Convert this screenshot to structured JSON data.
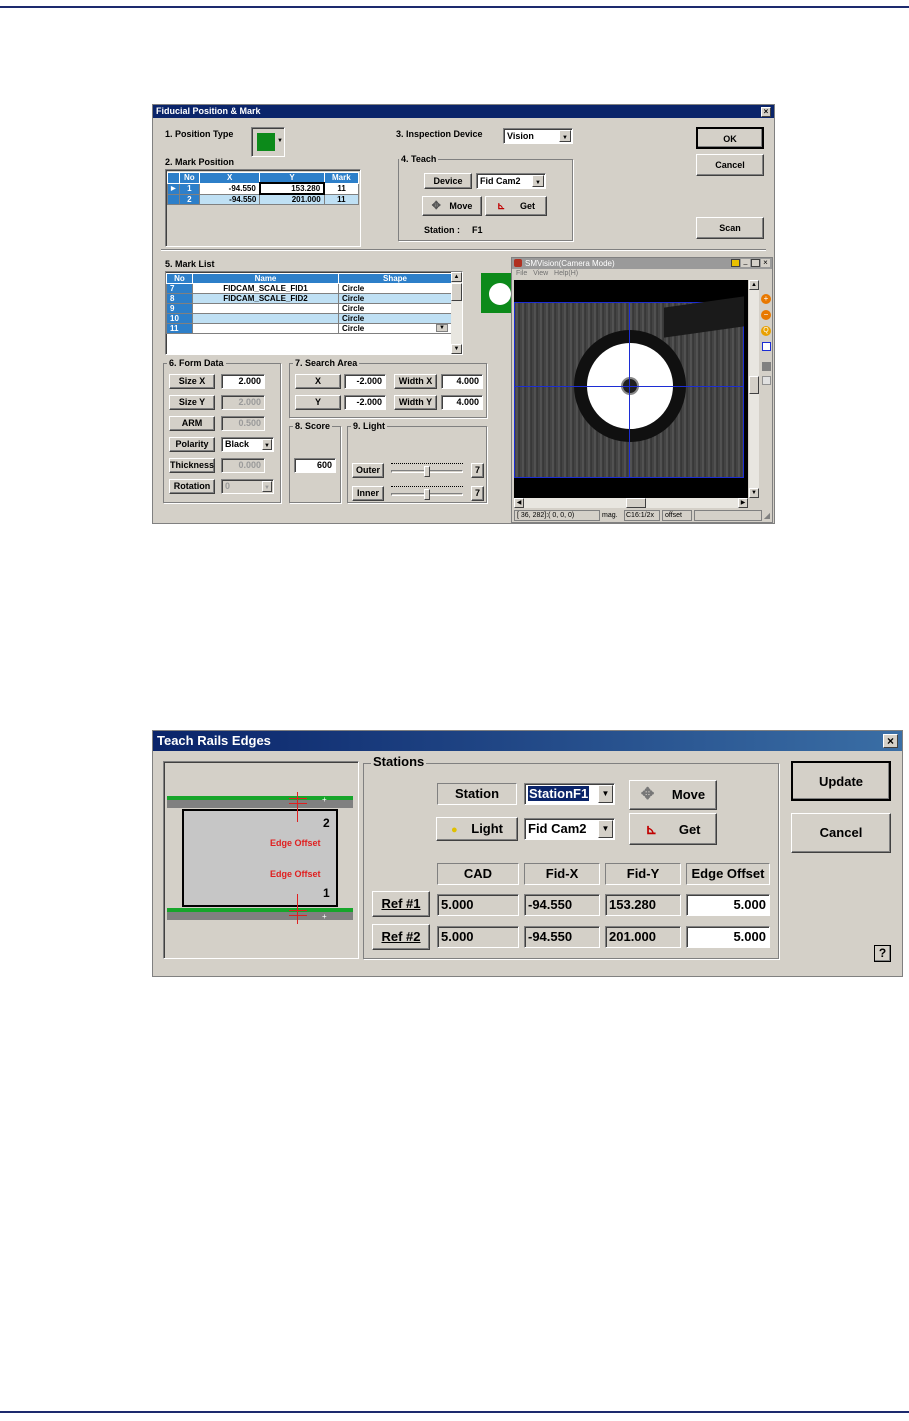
{
  "dialog1": {
    "title": "Fiducial Position & Mark",
    "position_type": {
      "label": "1. Position Type"
    },
    "mark_position": {
      "label": "2. Mark Position",
      "headers": [
        "No",
        "X",
        "Y",
        "Mark"
      ],
      "rows": [
        {
          "no": "1",
          "x": "-94.550",
          "y": "153.280",
          "mark": "11"
        },
        {
          "no": "2",
          "x": "-94.550",
          "y": "201.000",
          "mark": "11"
        }
      ]
    },
    "inspection_device": {
      "label": "3. Inspection Device",
      "value": "Vision"
    },
    "teach": {
      "label": "4. Teach",
      "device_label": "Device",
      "device_value": "Fid Cam2",
      "move_label": "Move",
      "get_label": "Get",
      "station_label": "Station :",
      "station_value": "F1"
    },
    "buttons": {
      "ok": "OK",
      "cancel": "Cancel",
      "scan": "Scan"
    },
    "mark_list": {
      "label": "5. Mark List",
      "headers": [
        "No",
        "Name",
        "Shape"
      ],
      "rows": [
        {
          "no": "7",
          "name": "FIDCAM_SCALE_FID1",
          "shape": "Circle"
        },
        {
          "no": "8",
          "name": "FIDCAM_SCALE_FID2",
          "shape": "Circle"
        },
        {
          "no": "9",
          "name": "",
          "shape": "Circle"
        },
        {
          "no": "10",
          "name": "",
          "shape": "Circle"
        },
        {
          "no": "11",
          "name": "",
          "shape": "Circle"
        }
      ]
    },
    "form_data": {
      "label": "6. Form Data",
      "size_x_label": "Size X",
      "size_x": "2.000",
      "size_y_label": "Size Y",
      "size_y": "2.000",
      "arm_label": "ARM",
      "arm": "0.500",
      "polarity_label": "Polarity",
      "polarity": "Black",
      "thickness_label": "Thickness",
      "thickness": "0.000",
      "rotation_label": "Rotation",
      "rotation": "0"
    },
    "search_area": {
      "label": "7. Search Area",
      "x_label": "X",
      "x": "-2.000",
      "y_label": "Y",
      "y": "-2.000",
      "width_x_label": "Width X",
      "width_x": "4.000",
      "width_y_label": "Width Y",
      "width_y": "4.000"
    },
    "score": {
      "label": "8. Score",
      "value": "600"
    },
    "light": {
      "label": "9. Light",
      "outer_label": "Outer",
      "outer_value": "7",
      "outer_level": 0.5,
      "inner_label": "Inner",
      "inner_value": "7",
      "inner_level": 0.5
    },
    "vision": {
      "title": "SMVision(Camera Mode)",
      "menu": [
        "File",
        "View",
        "Help(H)"
      ],
      "status_coords": "[ 36, 282]:( 0,  0,  0)",
      "status_mag_label": "mag.",
      "status_mag": "C16:1/2x",
      "status_offset": "offset"
    }
  },
  "dialog2": {
    "title": "Teach Rails Edges",
    "diagram": {
      "label_2": "2",
      "label_1": "1",
      "edge_offset_top": "Edge Offset",
      "edge_offset_bottom": "Edge Offset"
    },
    "stations": {
      "label": "Stations",
      "station_label": "Station",
      "station_value": "StationF1",
      "move_label": "Move",
      "light_label": "Light",
      "camera_value": "Fid Cam2",
      "get_label": "Get",
      "headers": [
        "CAD",
        "Fid-X",
        "Fid-Y",
        "Edge Offset"
      ],
      "refs": [
        {
          "label": "Ref #1",
          "cad": "5.000",
          "fid_x": "-94.550",
          "fid_y": "153.280",
          "edge_offset": "5.000"
        },
        {
          "label": "Ref #2",
          "cad": "5.000",
          "fid_x": "-94.550",
          "fid_y": "201.000",
          "edge_offset": "5.000"
        }
      ]
    },
    "buttons": {
      "update": "Update",
      "cancel": "Cancel",
      "help": "?"
    }
  },
  "colors": {
    "title_bar": "#0a246a",
    "dialog_bg": "#d4d0c8",
    "table_header": "#2d7fc9",
    "position_swatch": "#0c8a1a",
    "crosshair": "#1c2dd4",
    "edge_offset_text": "#e02020",
    "rail_green": "#17a52b"
  }
}
